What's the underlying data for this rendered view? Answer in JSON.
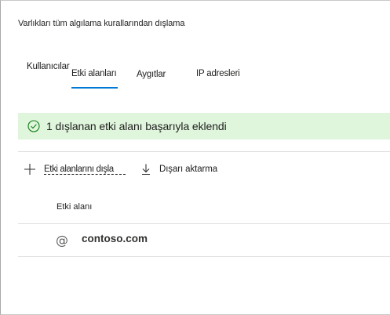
{
  "page": {
    "title": "Varlıkları tüm algılama kurallarından dışlama"
  },
  "tabs": [
    {
      "label": "Kullanıcılar",
      "selected": false
    },
    {
      "label": "Etki alanları",
      "selected": true
    },
    {
      "label": "Aygıtlar",
      "selected": false
    },
    {
      "label": "IP adresleri",
      "selected": false
    }
  ],
  "banner": {
    "text": "1 dışlanan etki alanı başarıyla eklendi",
    "icon": "checkmark-circle-icon",
    "color": "#dff6dd"
  },
  "toolbar": {
    "add_label": "Etki alanlarını dışla",
    "add_icon": "plus-icon",
    "export_label": "Dışarı aktarma",
    "export_icon": "download-icon"
  },
  "table": {
    "columns": [
      "Etki alanı"
    ],
    "rows": [
      {
        "icon": "at-sign-icon",
        "glyph": "@",
        "domain": "contoso.com"
      }
    ]
  },
  "colors": {
    "accent": "#0078d4",
    "success_bg": "#dff6dd",
    "success_icon": "#107c10"
  }
}
